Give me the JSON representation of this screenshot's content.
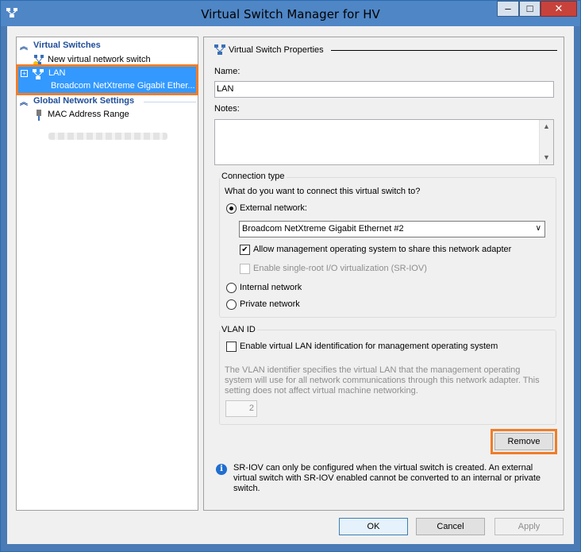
{
  "window": {
    "title": "Virtual Switch Manager for HV",
    "min_glyph": "–",
    "max_glyph": "□",
    "close_glyph": "✕"
  },
  "left": {
    "virtual_switches_header": "Virtual Switches",
    "new_switch": "New virtual network switch",
    "lan": {
      "name": "LAN",
      "expand": "+",
      "adapter": "Broadcom NetXtreme Gigabit Ether..."
    },
    "global_header": "Global Network Settings",
    "mac_range": "MAC Address Range"
  },
  "props": {
    "title": "Virtual Switch Properties",
    "name_label": "Name:",
    "name_value": "LAN",
    "notes_label": "Notes:",
    "connection_type": "Connection type",
    "connect_question": "What do you want to connect this virtual switch to?",
    "external": "External network:",
    "adapter_selected": "Broadcom NetXtreme Gigabit Ethernet #2",
    "allow_mgmt": "Allow management operating system to share this network adapter",
    "sriov": "Enable single-root I/O virtualization (SR-IOV)",
    "internal": "Internal network",
    "private": "Private network",
    "vlan_group": "VLAN ID",
    "vlan_enable": "Enable virtual LAN identification for management operating system",
    "vlan_desc": "The VLAN identifier specifies the virtual LAN that the management operating system will use for all network communications through this network adapter. This setting does not affect virtual machine networking.",
    "vlan_value": "2",
    "remove": "Remove",
    "info_glyph": "i",
    "info": "SR-IOV can only be configured when the virtual switch is created. An external virtual switch with SR-IOV enabled cannot be converted to an internal or private switch."
  },
  "buttons": {
    "ok": "OK",
    "cancel": "Cancel",
    "apply": "Apply"
  },
  "state": {
    "external_selected": true,
    "allow_mgmt_checked": true,
    "sriov_checked": false,
    "vlan_checked": false
  },
  "colors": {
    "title_bar": "#4f86c6",
    "selection": "#3399ff",
    "highlight_outline": "#f07d2a",
    "section_header": "#1f4e99"
  }
}
